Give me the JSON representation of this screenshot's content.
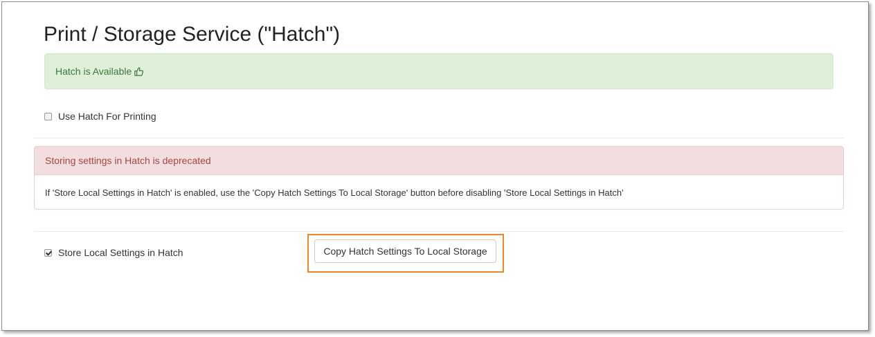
{
  "page": {
    "title": "Print / Storage Service (\"Hatch\")"
  },
  "status": {
    "text": "Hatch is Available",
    "icon": "thumbs-up-icon",
    "color": "#3c763d"
  },
  "use_hatch_printing": {
    "label": "Use Hatch For Printing",
    "checked": false
  },
  "deprecation_panel": {
    "heading": "Storing settings in Hatch is deprecated",
    "body": "If 'Store Local Settings in Hatch' is enabled, use the 'Copy Hatch Settings To Local Storage' button before disabling 'Store Local Settings in Hatch'",
    "heading_color": "#a94442"
  },
  "store_local_settings": {
    "label": "Store Local Settings in Hatch",
    "checked": true
  },
  "copy_button": {
    "label": "Copy Hatch Settings To Local Storage"
  },
  "highlight_color": "#f0871e"
}
